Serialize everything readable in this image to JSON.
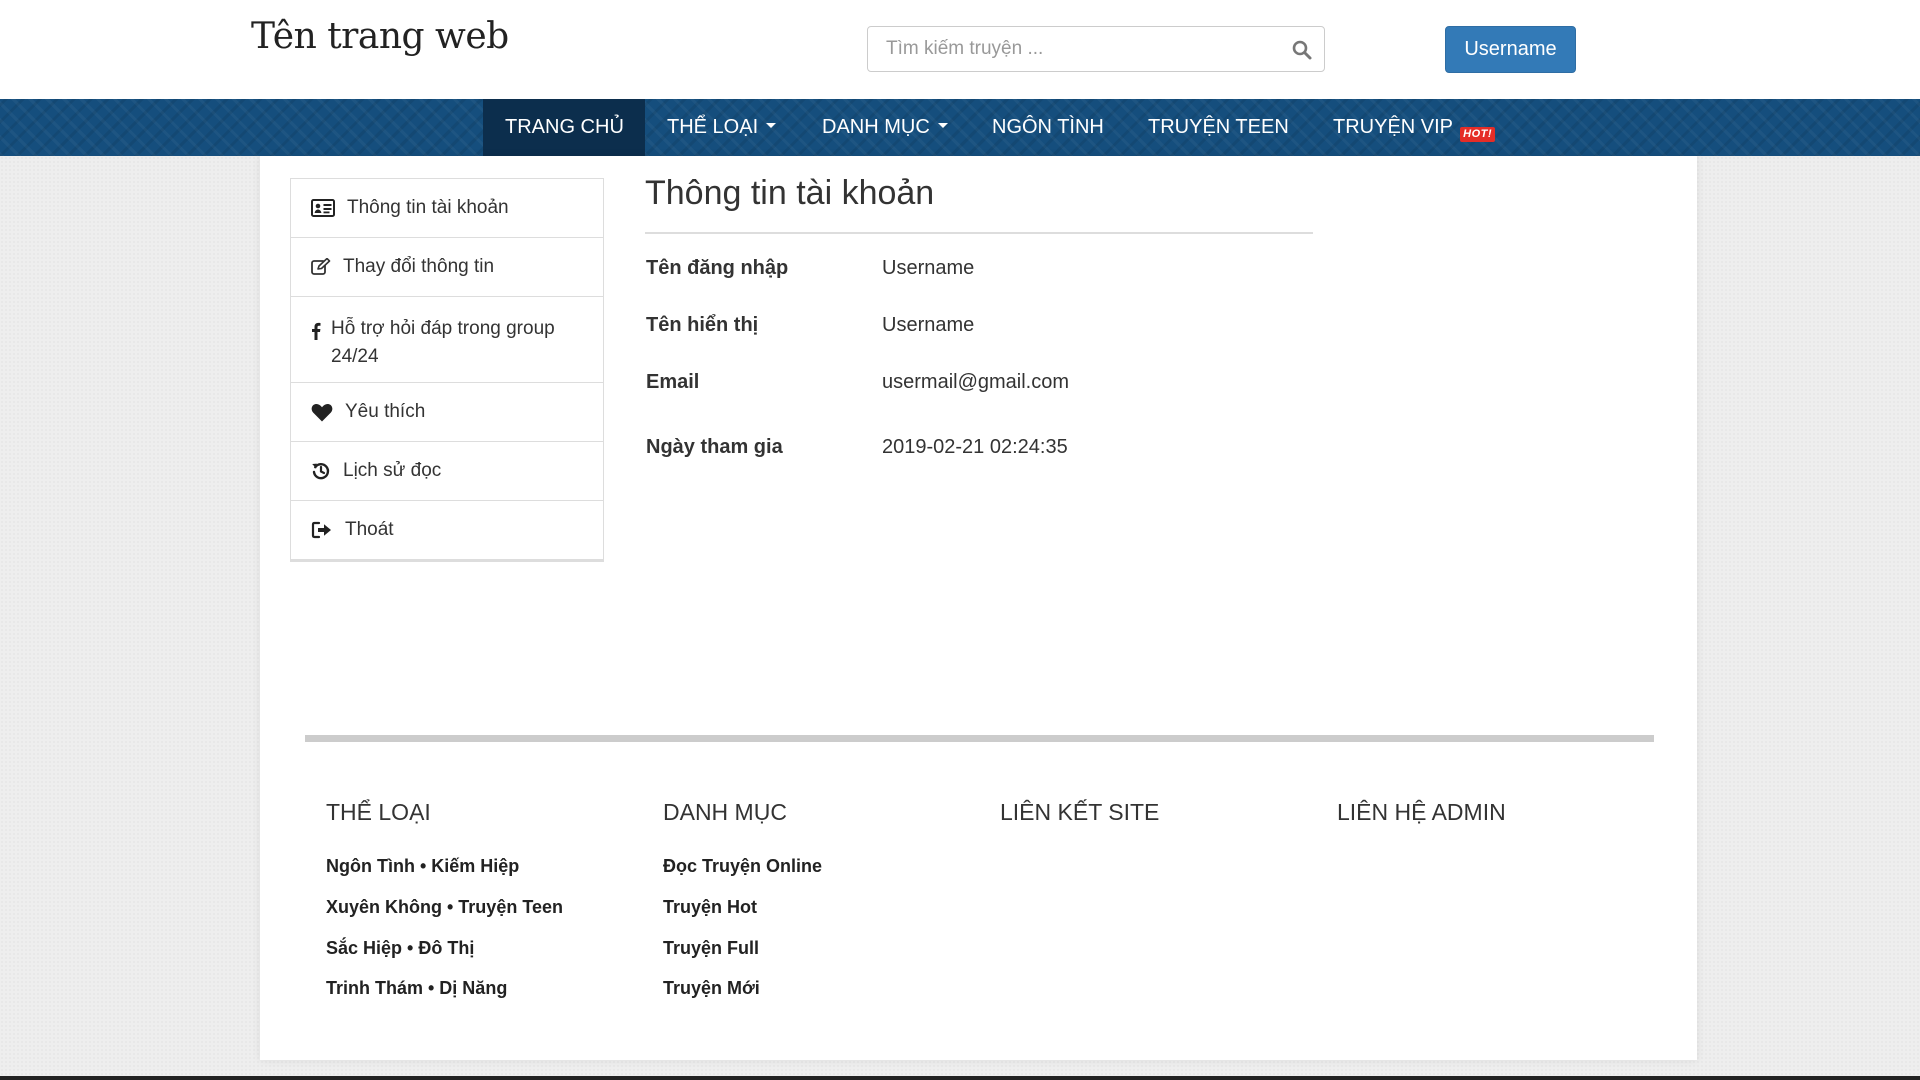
{
  "header": {
    "site_title": "Tên trang web",
    "search_placeholder": "Tìm kiếm truyện ...",
    "user_button": "Username"
  },
  "nav": {
    "items": [
      {
        "label": "TRANG CHỦ"
      },
      {
        "label": "THỂ LOẠI"
      },
      {
        "label": "DANH MỤC"
      },
      {
        "label": "NGÔN TÌNH"
      },
      {
        "label": "TRUYỆN TEEN"
      },
      {
        "label": "TRUYỆN VIP"
      }
    ],
    "hot_badge": "HOT!"
  },
  "sidebar": {
    "items": [
      {
        "label": "Thông tin tài khoản",
        "icon": "id-card-icon"
      },
      {
        "label": "Thay đổi thông tin",
        "icon": "edit-icon"
      },
      {
        "label": "Hỗ trợ hỏi đáp trong group 24/24",
        "icon": "facebook-icon"
      },
      {
        "label": "Yêu thích",
        "icon": "heart-icon"
      },
      {
        "label": "Lịch sử đọc",
        "icon": "history-icon"
      },
      {
        "label": "Thoát",
        "icon": "sign-out-icon"
      }
    ]
  },
  "account": {
    "title": "Thông tin tài khoản",
    "rows": [
      {
        "label": "Tên đăng nhập",
        "value": "Username"
      },
      {
        "label": "Tên hiển thị",
        "value": "Username"
      },
      {
        "label": "Email",
        "value": "usermail@gmail.com"
      },
      {
        "label": "Ngày tham gia",
        "value": "2019-02-21 02:24:35"
      }
    ]
  },
  "footer": {
    "columns": [
      {
        "title": "THỂ LOẠI",
        "links": [
          "Ngôn Tình • Kiếm Hiệp",
          "Xuyên Không • Truyện Teen",
          "Sắc Hiệp • Đô Thị",
          "Trinh Thám • Dị Năng"
        ]
      },
      {
        "title": "DANH MỤC",
        "links": [
          "Đọc Truyện Online",
          "Truyện Hot",
          "Truyện Full",
          "Truyện Mới"
        ]
      },
      {
        "title": "LIÊN KẾT SITE",
        "links": []
      },
      {
        "title": "LIÊN HỆ ADMIN",
        "links": []
      }
    ]
  },
  "colors": {
    "nav_bg": "#154e7d",
    "nav_active": "#0c2e4d",
    "primary_button": "#337ab7",
    "hot_badge": "#e52d27"
  }
}
